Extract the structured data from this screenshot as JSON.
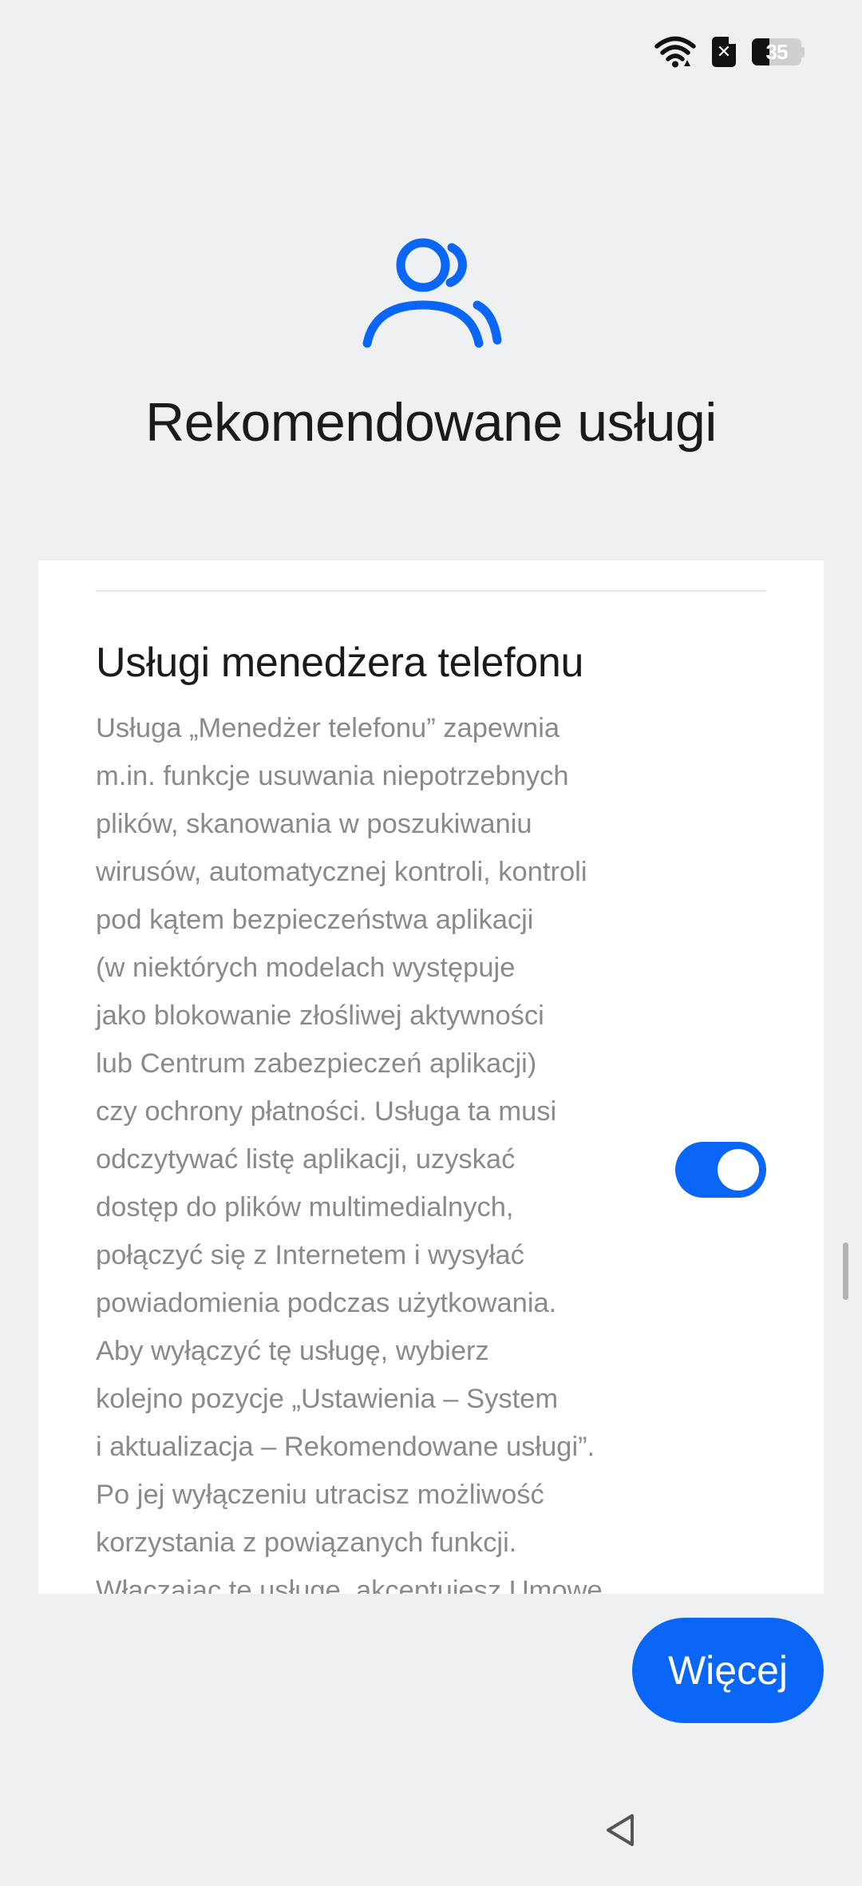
{
  "status_bar": {
    "wifi_icon": "wifi-icon",
    "sim_icon": "sim-error-icon",
    "sim_symbol": "✕",
    "battery_level": "35",
    "battery_fraction": 0.35
  },
  "header": {
    "icon": "users-icon",
    "title": "Rekomendowane usługi",
    "accent_color": "#0a66f6"
  },
  "service": {
    "title": "Usługi menedżera telefonu",
    "description_lines": [
      "Usługa „Menedżer telefonu” zapewnia",
      "m.in. funkcje usuwania niepotrzebnych",
      "plików, skanowania w poszukiwaniu",
      "wirusów, automatycznej kontroli, kontroli",
      "pod kątem bezpieczeństwa aplikacji",
      "(w niektórych modelach występuje",
      "jako blokowanie złośliwej aktywności",
      "lub Centrum zabezpieczeń aplikacji)",
      "czy ochrony płatności. Usługa ta musi",
      "odczytywać listę aplikacji, uzyskać",
      "dostęp do plików multimedialnych,",
      "połączyć się z Internetem i wysyłać",
      "powiadomienia podczas użytkowania.",
      "Aby wyłączyć tę usługę, wybierz",
      "kolejno pozycje „Ustawienia – System",
      "i aktualizacja – Rekomendowane usługi”.",
      "Po jej wyłączeniu utracisz możliwość",
      "korzystania z powiązanych funkcji.",
      "Włączając tę usługę, akceptujesz Umowę"
    ],
    "toggle_on": true
  },
  "actions": {
    "more_label": "Więcej"
  },
  "nav": {
    "back_icon": "back-triangle-icon"
  }
}
